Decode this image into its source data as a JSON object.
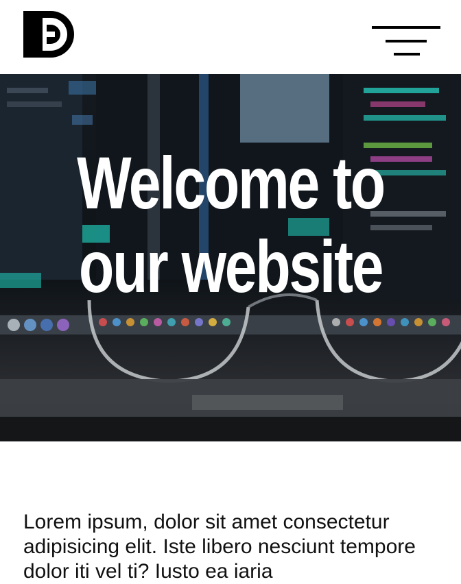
{
  "header": {
    "logo_icon": "db-monogram-logo",
    "menu_icon": "hamburger-menu-icon"
  },
  "hero": {
    "title_line1": "Welcome to",
    "title_line2": "our website",
    "background": "blurred-monitor-code-with-eyeglasses"
  },
  "content": {
    "paragraph": "Lorem ipsum, dolor sit amet consectetur adipisicing elit. Iste libero nesciunt tempore dolor iti vel ti? Iusto ea iaria"
  },
  "colors": {
    "text": "#111111",
    "hero_text": "#ffffff",
    "accent_code_teal": "#1fc2b0"
  }
}
